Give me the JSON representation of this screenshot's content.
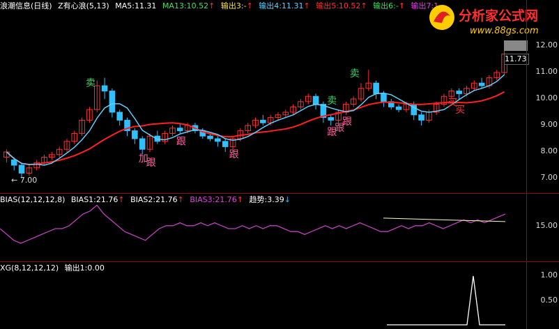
{
  "main": {
    "title": "浪潮信息(日线)",
    "indicator": "Z有心浪(5,13)",
    "ma5": "MA5:11.31",
    "ma13": "MA13:10.52",
    "out3": "输出3:-",
    "out4": "输出4:11.31",
    "out5": "输出5:10.52",
    "out6": "输出6:-",
    "out7": "输出7:1",
    "low_label": "7.00",
    "last_price": "11.73",
    "ticks": [
      "12.00",
      "11.00",
      "10.00",
      "9.00",
      "8.00",
      "7.00"
    ],
    "signals": [
      {
        "text": "卖",
        "color": "#40d060"
      },
      {
        "text": "卖",
        "color": "#40d060"
      },
      {
        "text": "卖",
        "color": "#40d060"
      },
      {
        "text": "加",
        "color": "#ff60a0"
      },
      {
        "text": "跟",
        "color": "#ff60a0"
      },
      {
        "text": "跟",
        "color": "#ff60a0"
      },
      {
        "text": "跟",
        "color": "#ff60a0"
      },
      {
        "text": "跟",
        "color": "#ff60a0"
      },
      {
        "text": "跟",
        "color": "#ff60a0"
      },
      {
        "text": "跟",
        "color": "#ff60a0"
      },
      {
        "text": "买",
        "color": "#ff3030"
      },
      {
        "text": "买",
        "color": "#ff3030"
      }
    ],
    "candles": [
      [
        7.8,
        8.0,
        7.6,
        8.1
      ],
      [
        7.7,
        7.5,
        7.3,
        7.8
      ],
      [
        7.5,
        7.2,
        7.0,
        7.6
      ],
      [
        7.2,
        7.4,
        7.1,
        7.5
      ],
      [
        7.4,
        7.6,
        7.3,
        7.7
      ],
      [
        7.6,
        7.8,
        7.5,
        7.9
      ],
      [
        7.8,
        7.9,
        7.7,
        8.0
      ],
      [
        7.9,
        8.1,
        7.8,
        8.2
      ],
      [
        8.1,
        8.4,
        8.0,
        8.5
      ],
      [
        8.4,
        8.7,
        8.3,
        8.8
      ],
      [
        8.7,
        9.2,
        8.6,
        9.3
      ],
      [
        9.2,
        9.6,
        9.1,
        9.7
      ],
      [
        9.6,
        10.5,
        9.5,
        10.7
      ],
      [
        10.5,
        10.3,
        10.0,
        10.8
      ],
      [
        10.3,
        9.5,
        9.3,
        10.4
      ],
      [
        9.5,
        9.2,
        9.0,
        9.6
      ],
      [
        9.2,
        8.8,
        8.6,
        9.3
      ],
      [
        8.8,
        8.5,
        8.3,
        8.9
      ],
      [
        8.5,
        8.1,
        7.9,
        8.6
      ],
      [
        8.1,
        8.6,
        8.0,
        8.7
      ],
      [
        8.6,
        8.4,
        8.3,
        8.8
      ],
      [
        8.4,
        8.7,
        8.3,
        8.8
      ],
      [
        8.7,
        8.9,
        8.6,
        9.0
      ],
      [
        8.9,
        8.8,
        8.7,
        9.1
      ],
      [
        8.8,
        9.0,
        8.7,
        9.1
      ],
      [
        9.0,
        8.8,
        8.7,
        9.1
      ],
      [
        8.8,
        8.6,
        8.5,
        8.9
      ],
      [
        8.6,
        8.5,
        8.4,
        8.7
      ],
      [
        8.5,
        8.4,
        8.2,
        8.6
      ],
      [
        8.4,
        8.2,
        8.0,
        8.5
      ],
      [
        8.2,
        8.5,
        8.1,
        8.6
      ],
      [
        8.5,
        8.8,
        8.4,
        8.9
      ],
      [
        8.8,
        9.0,
        8.7,
        9.1
      ],
      [
        9.0,
        9.2,
        8.9,
        9.3
      ],
      [
        9.2,
        9.1,
        9.0,
        9.4
      ],
      [
        9.1,
        9.3,
        9.0,
        9.4
      ],
      [
        9.3,
        9.4,
        9.2,
        9.5
      ],
      [
        9.4,
        9.5,
        9.3,
        9.6
      ],
      [
        9.5,
        9.7,
        9.4,
        9.8
      ],
      [
        9.7,
        9.9,
        9.6,
        10.0
      ],
      [
        9.9,
        10.1,
        9.8,
        10.2
      ],
      [
        10.1,
        9.8,
        9.6,
        10.2
      ],
      [
        9.8,
        9.3,
        9.1,
        9.9
      ],
      [
        9.3,
        9.2,
        9.0,
        9.4
      ],
      [
        9.2,
        9.5,
        9.1,
        9.6
      ],
      [
        9.5,
        9.8,
        9.4,
        9.9
      ],
      [
        9.8,
        10.0,
        9.7,
        10.1
      ],
      [
        10.0,
        10.4,
        9.9,
        10.6
      ],
      [
        10.4,
        10.6,
        10.3,
        11.1
      ],
      [
        10.6,
        10.2,
        10.0,
        10.7
      ],
      [
        10.2,
        9.9,
        9.7,
        10.3
      ],
      [
        9.9,
        9.7,
        9.6,
        10.0
      ],
      [
        9.7,
        9.6,
        9.5,
        9.8
      ],
      [
        9.6,
        9.8,
        9.5,
        9.9
      ],
      [
        9.8,
        9.4,
        9.2,
        9.9
      ],
      [
        9.4,
        9.2,
        9.0,
        9.5
      ],
      [
        9.2,
        9.5,
        9.1,
        9.6
      ],
      [
        9.5,
        9.8,
        9.4,
        9.9
      ],
      [
        9.8,
        10.1,
        9.7,
        10.2
      ],
      [
        10.1,
        10.3,
        10.0,
        10.4
      ],
      [
        10.3,
        10.2,
        10.0,
        10.4
      ],
      [
        10.2,
        10.4,
        10.1,
        10.5
      ],
      [
        10.4,
        10.6,
        10.3,
        10.7
      ],
      [
        10.6,
        10.5,
        10.4,
        10.8
      ],
      [
        10.5,
        10.8,
        10.4,
        10.9
      ],
      [
        10.8,
        11.0,
        10.7,
        11.1
      ],
      [
        11.0,
        11.7,
        10.9,
        12.0
      ]
    ]
  },
  "bias": {
    "title": "BIAS(12,12,12,8)",
    "bias1": "BIAS1:21.76",
    "bias2": "BIAS2:21.76",
    "bias3": "BIAS3:21.76",
    "trend": "趋势:3.39",
    "tick": "15.00",
    "values": [
      10,
      8,
      6,
      5,
      6,
      7,
      8,
      9,
      10,
      10,
      11,
      13,
      15,
      16,
      18,
      15,
      13,
      11,
      9,
      8,
      7,
      6,
      8,
      10,
      11,
      11,
      12,
      11,
      11,
      12,
      11,
      12,
      11,
      10,
      10,
      11,
      10,
      11,
      10,
      11,
      11,
      10,
      9,
      9,
      8,
      9,
      10,
      11,
      10,
      11,
      10,
      11,
      12,
      11,
      10,
      9,
      9,
      10,
      11,
      10,
      11,
      11,
      12,
      11,
      10,
      11,
      12,
      13,
      12,
      13,
      12,
      13,
      14,
      15
    ]
  },
  "xg": {
    "title": "XG(8,12,12,12)",
    "out1": "输出1:0.00",
    "ticks": [
      "1.00",
      "0.50"
    ]
  },
  "logo": {
    "brand": "分析家公式网",
    "url": "www.88gs.com"
  },
  "colors": {
    "ma5": "#60d0ff",
    "ma13": "#ff2020",
    "rise": "#ff3030",
    "fall": "#30c0ff",
    "bias": "#c040c0"
  }
}
